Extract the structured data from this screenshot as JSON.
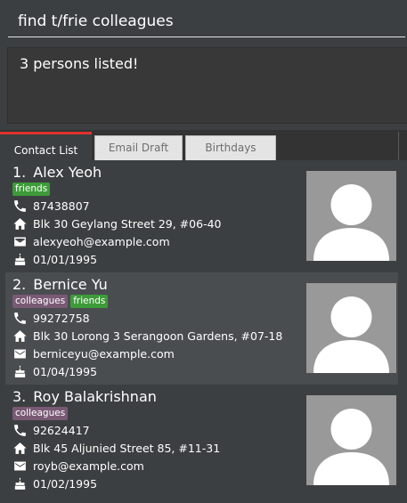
{
  "command": {
    "value": "find t/frie colleagues",
    "placeholder": ""
  },
  "result": {
    "text": "3 persons listed!"
  },
  "tabs": [
    {
      "label": "Contact List",
      "active": true
    },
    {
      "label": "Email Draft",
      "active": false
    },
    {
      "label": "Birthdays",
      "active": false
    }
  ],
  "persons": [
    {
      "index": "1.",
      "name": "Alex Yeoh",
      "tags": [
        "friends"
      ],
      "phone": "87438807",
      "address": "Blk 30 Geylang Street 29, #06-40",
      "email": "alexyeoh@example.com",
      "birthday": "01/01/1995"
    },
    {
      "index": "2.",
      "name": "Bernice Yu",
      "tags": [
        "colleagues",
        "friends"
      ],
      "phone": "99272758",
      "address": "Blk 30 Lorong 3 Serangoon Gardens, #07-18",
      "email": "berniceyu@example.com",
      "birthday": "01/04/1995"
    },
    {
      "index": "3.",
      "name": "Roy Balakrishnan",
      "tags": [
        "colleagues"
      ],
      "phone": "92624417",
      "address": "Blk 45 Aljunied Street 85, #11-31",
      "email": "royb@example.com",
      "birthday": "01/02/1995"
    }
  ],
  "colors": {
    "background": "#3c3f41",
    "active_tab_accent": "#e0322e",
    "tag_friends": "#3e9b3a",
    "tag_colleagues": "#795a75",
    "card_alt": "#4a4d50",
    "photo_bg": "#999999"
  },
  "icons": {
    "phone": "phone-icon",
    "address": "home-icon",
    "email": "mail-icon",
    "birthday": "cake-icon",
    "photo": "person-silhouette-icon"
  }
}
